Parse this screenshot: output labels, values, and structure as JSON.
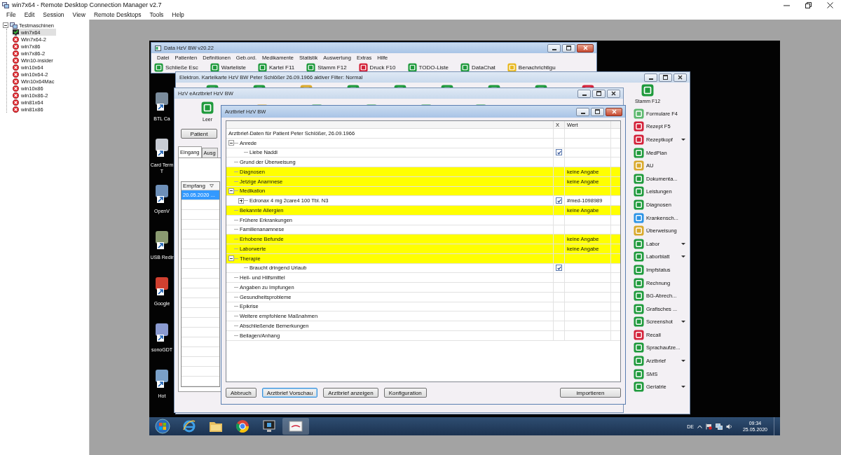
{
  "app": {
    "title": "win7x64 - Remote Desktop Connection Manager v2.7",
    "menu": [
      "File",
      "Edit",
      "Session",
      "View",
      "Remote Desktops",
      "Tools",
      "Help"
    ]
  },
  "tree": {
    "root": {
      "label": "Testmaschinen",
      "expanded": true,
      "children": [
        {
          "label": "win7x64",
          "connected": true,
          "selected": true
        },
        {
          "label": "Win7x64-2",
          "connected": false,
          "selected": false
        },
        {
          "label": "win7x86",
          "connected": false,
          "selected": false
        },
        {
          "label": "win7x86-2",
          "connected": false,
          "selected": false
        },
        {
          "label": "Win10-insider",
          "connected": false,
          "selected": false
        },
        {
          "label": "win10x64",
          "connected": false,
          "selected": false
        },
        {
          "label": "win10x64-2",
          "connected": false,
          "selected": false
        },
        {
          "label": "Win10x64Mac",
          "connected": false,
          "selected": false
        },
        {
          "label": "win10x86",
          "connected": false,
          "selected": false
        },
        {
          "label": "win10x86-2",
          "connected": false,
          "selected": false
        },
        {
          "label": "win81x64",
          "connected": false,
          "selected": false
        },
        {
          "label": "win81x86",
          "connected": false,
          "selected": false
        }
      ]
    }
  },
  "remote": {
    "main_window": {
      "title": "Data HzV BW v20.22",
      "menu": [
        "Datei",
        "Patienten",
        "Definitionen",
        "Geb.ord.",
        "Medikamente",
        "Statistik",
        "Auswertung",
        "Extras",
        "Hilfe"
      ],
      "toolbar": [
        {
          "label": "Schließe Esc",
          "color": "#1f9a3c"
        },
        {
          "label": "Warteliste",
          "color": "#1f9a3c"
        },
        {
          "label": "Kartei F11",
          "color": "#1f9a3c"
        },
        {
          "label": "Stamm F12",
          "color": "#1f9a3c"
        },
        {
          "label": "Druck F10",
          "color": "#d3223a"
        },
        {
          "label": "TODO-Liste",
          "color": "#1f9a3c"
        },
        {
          "label": "DataChat",
          "color": "#1f9a3c"
        },
        {
          "label": "Benachrichtigu",
          "color": "#e8b820"
        }
      ]
    },
    "desktop_icons": [
      {
        "lines": [
          "BTL Ca"
        ]
      },
      {
        "lines": [
          "Card Term",
          "T"
        ]
      },
      {
        "lines": [
          "OpenV"
        ]
      },
      {
        "lines": [
          "USB Redir"
        ]
      },
      {
        "lines": [
          "Google"
        ]
      },
      {
        "lines": [
          "sonoGDT"
        ]
      },
      {
        "lines": [
          "Hot"
        ]
      }
    ],
    "karteikarte": {
      "title": "Elektron. Karteikarte HzV BW Peter Schlößer 26.09.1966  aktiver Filter: Normal",
      "stamm": "Stamm F12",
      "sidebar": [
        {
          "label": "Formulare F4",
          "color": "#5cb86e",
          "dropdown": false
        },
        {
          "label": "Rezept F5",
          "color": "#d3223a",
          "dropdown": false
        },
        {
          "label": "Rezeptkopf",
          "color": "#d3223a",
          "dropdown": true
        },
        {
          "label": "MedPlan",
          "color": "#1f9a3c",
          "dropdown": false
        },
        {
          "label": "AU",
          "color": "#d9a92c",
          "dropdown": false
        },
        {
          "label": "Dokumenta...",
          "color": "#1f9a3c",
          "dropdown": false
        },
        {
          "label": "Leistungen",
          "color": "#1f9a3c",
          "dropdown": false
        },
        {
          "label": "Diagnosen",
          "color": "#1f9a3c",
          "dropdown": false
        },
        {
          "label": "Krankensch...",
          "color": "#2b93e6",
          "dropdown": false
        },
        {
          "label": "Überweisung",
          "color": "#d9a92c",
          "dropdown": false
        },
        {
          "label": "Labor",
          "color": "#1f9a3c",
          "dropdown": true
        },
        {
          "label": "Laborblatt",
          "color": "#1f9a3c",
          "dropdown": true
        },
        {
          "label": "Impfstatus",
          "color": "#1f9a3c",
          "dropdown": false
        },
        {
          "label": "Rechnung",
          "color": "#1f9a3c",
          "dropdown": false
        },
        {
          "label": "BG-Abrech...",
          "color": "#1f9a3c",
          "dropdown": false
        },
        {
          "label": "Grafisches ...",
          "color": "#1f9a3c",
          "dropdown": false
        },
        {
          "label": "Screenshot",
          "color": "#1f9a3c",
          "dropdown": true
        },
        {
          "label": "Recall",
          "color": "#d3223a",
          "dropdown": false
        },
        {
          "label": "Sprachaufze...",
          "color": "#1f9a3c",
          "dropdown": false
        },
        {
          "label": "Arztbrief",
          "color": "#1f9a3c",
          "dropdown": true
        },
        {
          "label": "SMS",
          "color": "#1f9a3c",
          "dropdown": false
        },
        {
          "label": "Geriatrie",
          "color": "#1f9a3c",
          "dropdown": true
        }
      ]
    },
    "earztbrief": {
      "title": "HzV eArztbrief HzV BW",
      "leer": "Leer",
      "patient_button": "Patient",
      "tabs": [
        {
          "label": "Eingang",
          "selected": true
        },
        {
          "label": "Ausg",
          "selected": false
        }
      ],
      "table": {
        "columns": [
          "Empfang"
        ],
        "rows": [
          {
            "cell": "20.05.2020 ...",
            "selected": true
          }
        ]
      }
    },
    "dialog": {
      "title": "Arztbrief HzV BW",
      "columns": [
        "X",
        "Wert"
      ],
      "header_row": "Arztbrief-Daten für Patient Peter Schlößer, 26.09.1966",
      "rows": [
        {
          "label": "Anrede",
          "highlighted": false,
          "expanded": true,
          "children": [
            {
              "label": "Liebe Naddi",
              "highlighted": false,
              "checked": true
            }
          ]
        },
        {
          "label": "Grund der Überweisung",
          "highlighted": false
        },
        {
          "label": "Diagnosen",
          "highlighted": true,
          "value": "keine Angabe"
        },
        {
          "label": "Jetzige Anamnese",
          "highlighted": true,
          "value": "keine Angabe"
        },
        {
          "label": "Medikation",
          "highlighted": true,
          "expanded": true,
          "children": [
            {
              "label": "Edronax 4 mg 2care4 100 Tbl. N3",
              "highlighted": false,
              "checked": true,
              "value": "#med-1098989",
              "expanded": false
            }
          ]
        },
        {
          "label": "Bekannte Allergien",
          "highlighted": true,
          "value": "keine Angabe"
        },
        {
          "label": "Frühere Erkrankungen",
          "highlighted": false
        },
        {
          "label": "Familienanamnese",
          "highlighted": false
        },
        {
          "label": "Erhobene Befunde",
          "highlighted": true,
          "value": "keine Angabe"
        },
        {
          "label": "Laborwerte",
          "highlighted": true,
          "value": "keine Angabe"
        },
        {
          "label": "Therapie",
          "highlighted": true,
          "expanded": true,
          "children": [
            {
              "label": "Braucht dringend Urlaub",
              "highlighted": false,
              "checked": true
            }
          ]
        },
        {
          "label": "Heil- und Hilfsmittel",
          "highlighted": false
        },
        {
          "label": "Angaben zu Impfungen",
          "highlighted": false
        },
        {
          "label": "Gesundheitsprobleme",
          "highlighted": false
        },
        {
          "label": "Epikrise",
          "highlighted": false
        },
        {
          "label": "Weitere empfohlene Maßnahmen",
          "highlighted": false
        },
        {
          "label": "Abschließende Bemerkungen",
          "highlighted": false
        },
        {
          "label": "Beilagen/Anhang",
          "highlighted": false
        }
      ],
      "buttons": [
        {
          "label": "Abbruch",
          "default": false
        },
        {
          "label": "Arztbrief Vorschau",
          "default": true
        },
        {
          "label": "Arztbrief anzeigen",
          "default": false
        },
        {
          "label": "Konfiguration",
          "default": false
        }
      ],
      "import_button": "importieren"
    },
    "taskbar": {
      "language": "DE",
      "time": "09:34",
      "date": "25.05.2020"
    }
  }
}
